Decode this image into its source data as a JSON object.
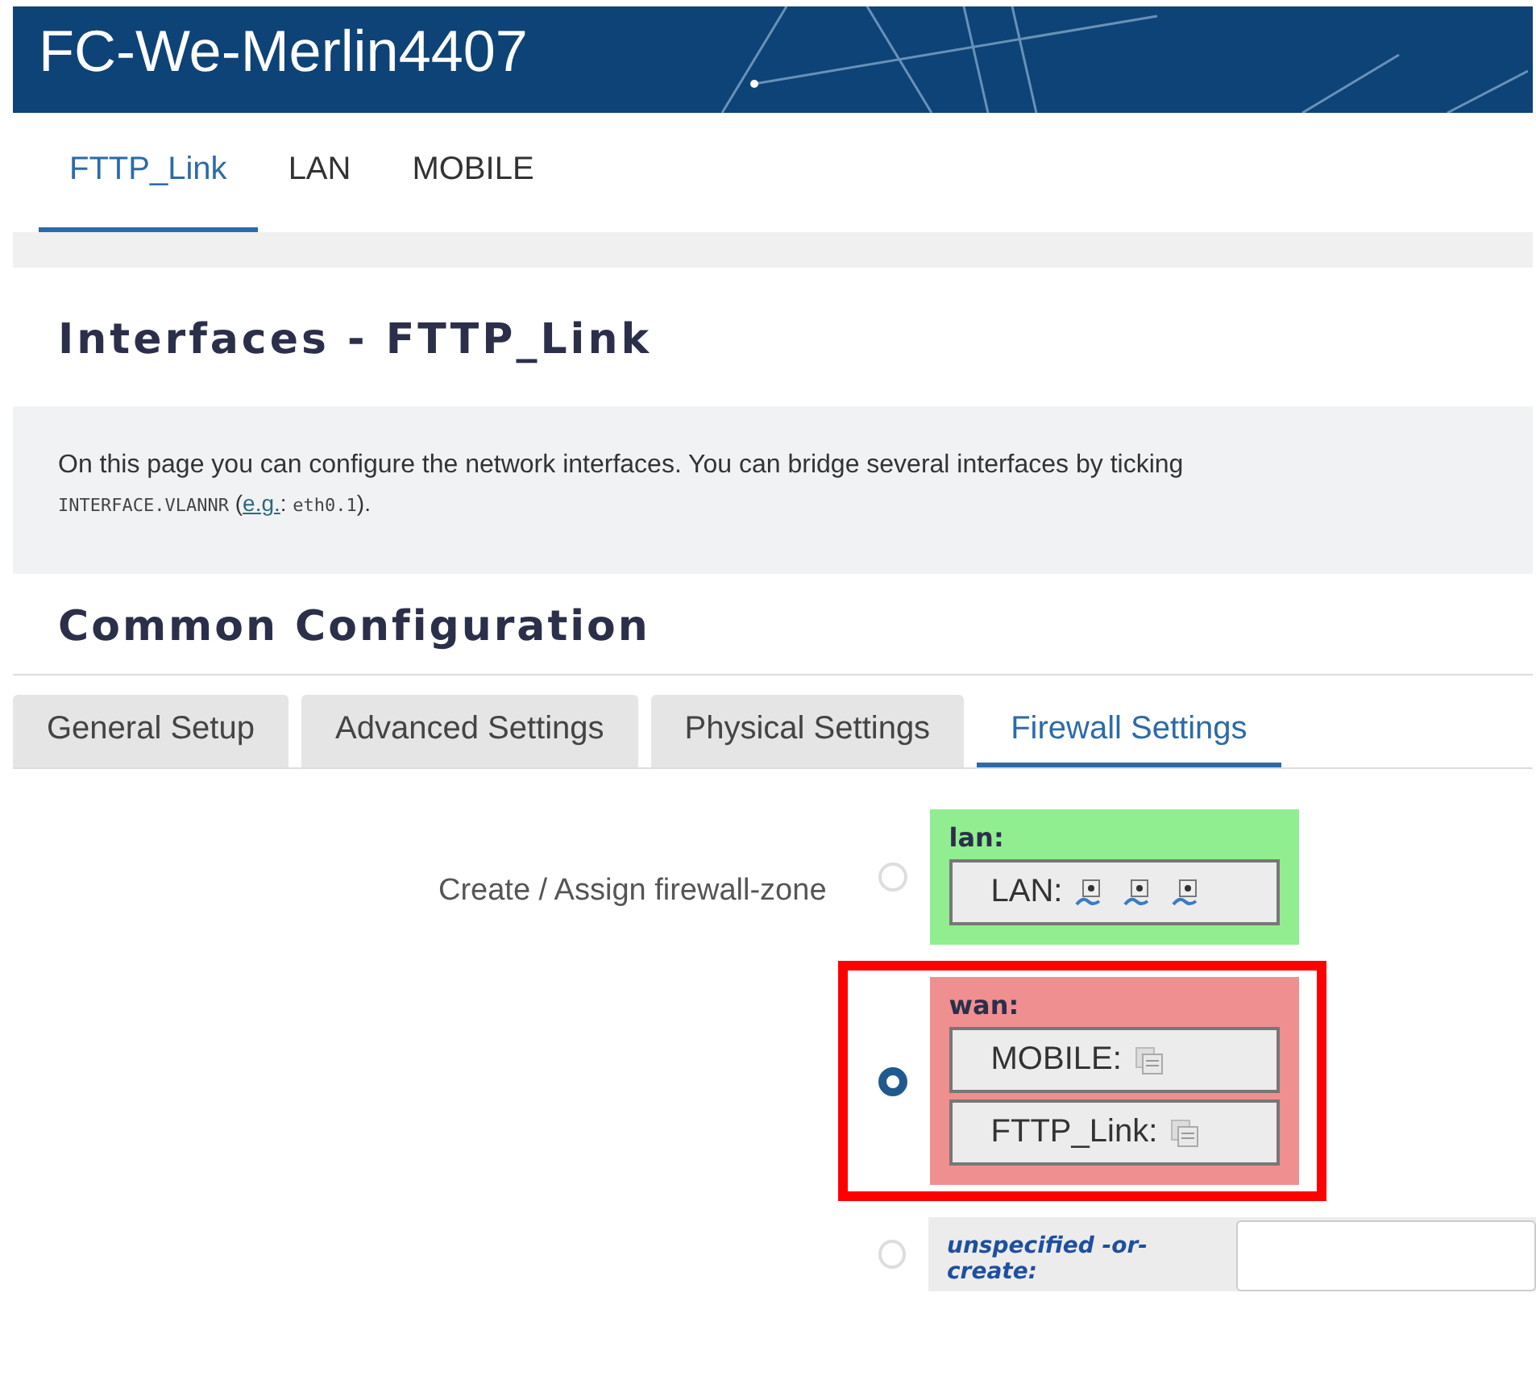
{
  "header": {
    "title": "FC-We-Merlin4407"
  },
  "interface_tabs": [
    {
      "label": "FTTP_Link",
      "selected": true
    },
    {
      "label": "LAN",
      "selected": false
    },
    {
      "label": "MOBILE",
      "selected": false
    }
  ],
  "page_title": "Interfaces - FTTP_Link",
  "description": {
    "text": "On this page you can configure the network interfaces. You can bridge several interfaces by ticking",
    "code": "INTERFACE.VLANNR",
    "open": "(",
    "link": "e.g.",
    "colon": ":",
    "example": "eth0.1",
    "close": ")."
  },
  "section_title": "Common Configuration",
  "config_tabs": [
    {
      "label": "General Setup",
      "selected": false
    },
    {
      "label": "Advanced Settings",
      "selected": false
    },
    {
      "label": "Physical Settings",
      "selected": false
    },
    {
      "label": "Firewall Settings",
      "selected": true
    }
  ],
  "firewall_field": {
    "label": "Create / Assign firewall-zone",
    "zones": [
      {
        "kind": "zone",
        "name": "lan:",
        "color": "#90ee90",
        "selected": false,
        "highlighted": false,
        "networks": [
          {
            "label": "LAN:",
            "devices": [
              {
                "kind": "port"
              },
              {
                "kind": "port"
              },
              {
                "kind": "port"
              }
            ]
          }
        ]
      },
      {
        "kind": "zone",
        "name": "wan:",
        "color": "#f08f8f",
        "selected": true,
        "highlighted": true,
        "networks": [
          {
            "label": "MOBILE:",
            "devices": [
              {
                "kind": "stack"
              }
            ]
          },
          {
            "label": "FTTP_Link:",
            "devices": [
              {
                "kind": "stack"
              }
            ]
          }
        ]
      },
      {
        "kind": "create",
        "name": "unspecified -or- create:",
        "selected": false,
        "highlighted": false
      }
    ]
  }
}
